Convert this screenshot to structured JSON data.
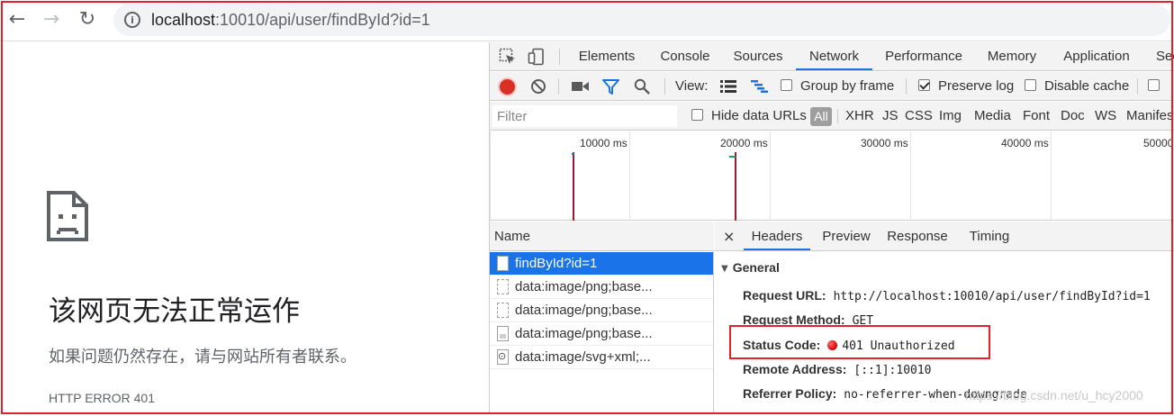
{
  "browser": {
    "url_host": "localhost",
    "url_path": ":10010/api/user/findById?id=1"
  },
  "error_page": {
    "title": "该网页无法正常运作",
    "description": "如果问题仍然存在，请与网站所有者联系。",
    "code": "HTTP ERROR 401"
  },
  "devtools": {
    "tabs": [
      "Elements",
      "Console",
      "Sources",
      "Network",
      "Performance",
      "Memory",
      "Application",
      "Sec"
    ],
    "active_tab": "Network",
    "toolbar": {
      "view_label": "View:",
      "group_by_frame": "Group by frame",
      "preserve_log": "Preserve log",
      "disable_cache": "Disable cache",
      "preserve_log_checked": true,
      "group_by_frame_checked": false,
      "disable_cache_checked": false
    },
    "filter": {
      "placeholder": "Filter",
      "hide_data_urls": "Hide data URLs",
      "types": [
        "All",
        "XHR",
        "JS",
        "CSS",
        "Img",
        "Media",
        "Font",
        "Doc",
        "WS",
        "Manifest"
      ]
    },
    "timeline_ticks": [
      "10000 ms",
      "20000 ms",
      "30000 ms",
      "40000 ms",
      "50000"
    ],
    "requests": {
      "header": "Name",
      "rows": [
        {
          "name": "findById?id=1",
          "icon": "document-icon",
          "selected": true
        },
        {
          "name": "data:image/png;base...",
          "icon": "image-file-icon",
          "selected": false
        },
        {
          "name": "data:image/png;base...",
          "icon": "image-file-icon",
          "selected": false
        },
        {
          "name": "data:image/png;base...",
          "icon": "image-file-icon",
          "selected": false
        },
        {
          "name": "data:image/svg+xml;...",
          "icon": "svg-file-icon",
          "selected": false
        }
      ]
    },
    "details": {
      "close_label": "×",
      "tabs": [
        "Headers",
        "Preview",
        "Response",
        "Timing"
      ],
      "active_tab": "Headers",
      "section": "General",
      "rows": [
        {
          "key": "Request URL:",
          "value": "http://localhost:10010/api/user/findById?id=1"
        },
        {
          "key": "Request Method:",
          "value": "GET"
        },
        {
          "key": "Status Code:",
          "value": "401 Unauthorized"
        },
        {
          "key": "Remote Address:",
          "value": "[::1]:10010"
        },
        {
          "key": "Referrer Policy:",
          "value": "no-referrer-when-downgrade"
        }
      ]
    }
  },
  "watermark": "https://blog.csdn.net/u_hcy2000",
  "colors": {
    "annotation_red": "#e0232a",
    "accent_blue": "#1a73e8",
    "record_red": "#d93025",
    "status_red": "#d40000"
  }
}
